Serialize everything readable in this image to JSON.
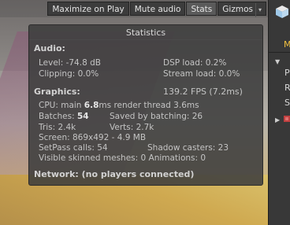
{
  "toolbar": {
    "maximize_label": "Maximize on Play",
    "mute_label": "Mute audio",
    "stats_label": "Stats",
    "gizmos_label": "Gizmos",
    "gizmos_arrow": "▾"
  },
  "side_panel": {
    "label_m": "M",
    "row_p": "P",
    "row_r": "R",
    "row_s": "S"
  },
  "stats": {
    "title": "Statistics",
    "audio_header": "Audio:",
    "level": "Level: -74.8 dB",
    "dsp_load": "DSP load: 0.2%",
    "clipping": "Clipping: 0.0%",
    "stream_load": "Stream load: 0.0%",
    "graphics_header": "Graphics:",
    "fps": "139.2 FPS (7.2ms)",
    "cpu_prefix": "CPU: main ",
    "cpu_main": "6.8",
    "cpu_suffix": "ms  render thread 3.6ms",
    "batches_prefix": "Batches: ",
    "batches_value": "54",
    "saved_by_batching": "Saved by batching: 26",
    "tris": "Tris: 2.4k",
    "verts": "Verts: 2.7k",
    "screen": "Screen: 869x492 - 4.9 MB",
    "setpass": "SetPass calls: 54",
    "shadow_casters": "Shadow casters: 23",
    "skinned_meshes": "Visible skinned meshes: 0  Animations: 0",
    "network": "Network: (no players connected)"
  }
}
